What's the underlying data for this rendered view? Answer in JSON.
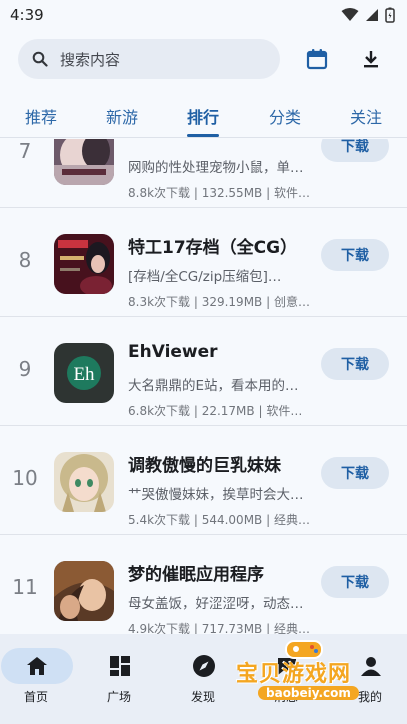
{
  "status": {
    "time": "4:39"
  },
  "search": {
    "placeholder": "搜索内容"
  },
  "tabs": [
    {
      "label": "推荐"
    },
    {
      "label": "新游"
    },
    {
      "label": "排行"
    },
    {
      "label": "分类"
    },
    {
      "label": "关注"
    }
  ],
  "active_tab": "排行",
  "items": [
    {
      "rank": "7",
      "title": "",
      "desc": "网购的性处理宠物小鼠，单…",
      "meta": "8.8k次下载 | 132.55MB | 软件…",
      "button": "下载"
    },
    {
      "rank": "8",
      "title": "特工17存档（全CG）",
      "desc": "[存档/全CG/zip压缩包]…",
      "meta": "8.3k次下载 | 329.19MB | 创意…",
      "button": "下载"
    },
    {
      "rank": "9",
      "title": "EhViewer",
      "desc": "大名鼎鼎的E站，看本用的…",
      "meta": "6.8k次下载 | 22.17MB | 软件…",
      "button": "下载"
    },
    {
      "rank": "10",
      "title": "调教傲慢的巨乳妹妹",
      "desc": "艹哭傲慢妹妹，挨草时会大…",
      "meta": "5.4k次下载 | 544.00MB | 经典…",
      "button": "下载"
    },
    {
      "rank": "11",
      "title": "梦的催眠应用程序",
      "desc": "母女盖饭，好涩涩呀，动态…",
      "meta": "4.9k次下载 | 717.73MB | 经典…",
      "button": "下载"
    }
  ],
  "eh_logo_text": "Eh",
  "nav": [
    {
      "label": "首页",
      "icon": "home-icon"
    },
    {
      "label": "广场",
      "icon": "grid-icon"
    },
    {
      "label": "发现",
      "icon": "compass-icon"
    },
    {
      "label": "消息",
      "icon": "message-icon"
    },
    {
      "label": "我的",
      "icon": "person-icon"
    }
  ],
  "watermark": {
    "text": "宝贝游戏网",
    "url": "baobeiy.com"
  },
  "colors": {
    "accent": "#1f5fa4",
    "pill_bg": "#dde6f1",
    "nav_bg": "#e9eef6",
    "page_bg": "#f6f9fd"
  }
}
